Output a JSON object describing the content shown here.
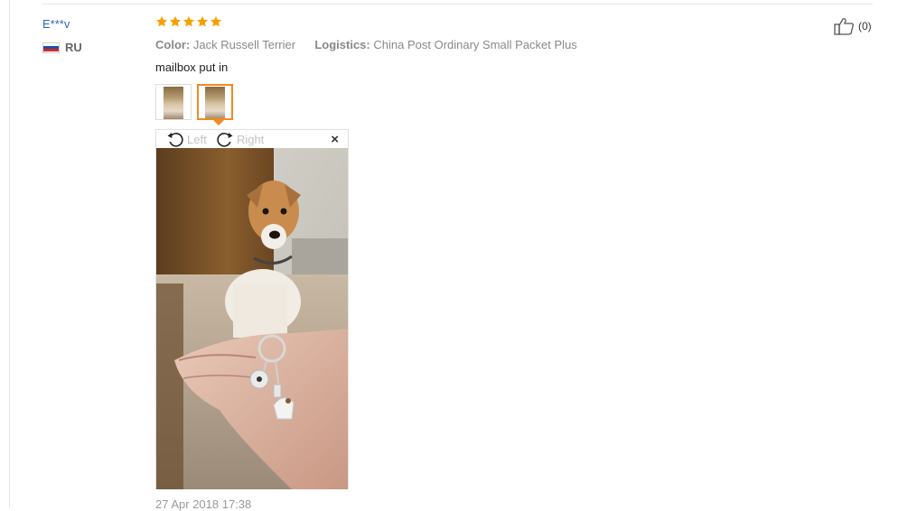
{
  "review": {
    "user_name": "E***v",
    "country_code": "RU",
    "rating": 5,
    "color_label": "Color:",
    "color_value": "Jack Russell Terrier",
    "logistics_label": "Logistics:",
    "logistics_value": "China Post Ordinary Small Packet Plus",
    "text": "mailbox put in",
    "thumbnails_count": 2,
    "active_thumbnail": 2,
    "viewer": {
      "rotate_left_label": "Left",
      "rotate_right_label": "Right",
      "close_label": "×"
    },
    "likes_label": "(0)",
    "date": "27 Apr 2018 17:38"
  },
  "colors": {
    "username": "#2d69b5",
    "star": "#f6a100",
    "active_border": "#f08a24"
  },
  "icons": [
    "flag-ru-icon",
    "star-icon",
    "rotate-left-icon",
    "rotate-right-icon",
    "close-icon",
    "thumbs-up-icon"
  ]
}
